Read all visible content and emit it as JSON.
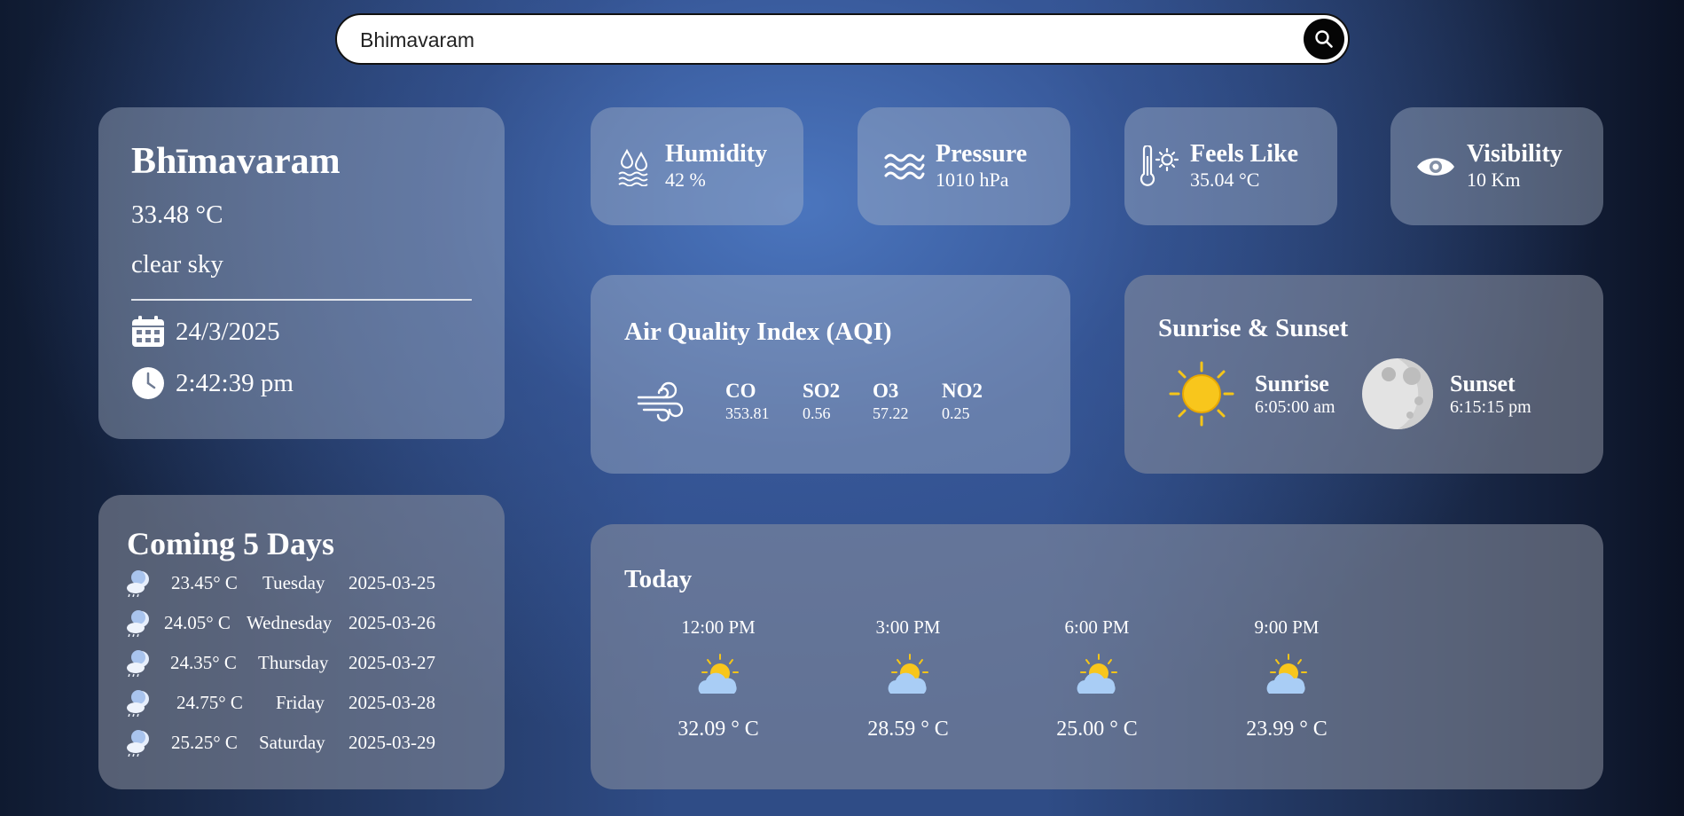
{
  "search": {
    "value": "Bhimavaram"
  },
  "current": {
    "city": "Bhīmavaram",
    "temperature": "33.48 °C",
    "description": "clear sky",
    "date": "24/3/2025",
    "time": "2:42:39 pm"
  },
  "stats": {
    "humidity": {
      "label": "Humidity",
      "value": "42 %"
    },
    "pressure": {
      "label": "Pressure",
      "value": "1010 hPa"
    },
    "feels_like": {
      "label": "Feels Like",
      "value": "35.04 °C"
    },
    "visibility": {
      "label": "Visibility",
      "value": "10 Km"
    }
  },
  "aqi": {
    "title": "Air Quality Index (AQI)",
    "items": [
      {
        "name": "CO",
        "value": "353.81"
      },
      {
        "name": "SO2",
        "value": "0.56"
      },
      {
        "name": "O3",
        "value": "57.22"
      },
      {
        "name": "NO2",
        "value": "0.25"
      }
    ]
  },
  "sun": {
    "title": "Sunrise & Sunset",
    "sunrise_label": "Sunrise",
    "sunrise": "6:05:00 am",
    "sunset_label": "Sunset",
    "sunset": "6:15:15 pm"
  },
  "forecast": {
    "title": "Coming 5 Days",
    "days": [
      {
        "temp": "23.45° C",
        "day": "Tuesday",
        "date": "2025-03-25"
      },
      {
        "temp": "24.05° C",
        "day": "Wednesday",
        "date": "2025-03-26"
      },
      {
        "temp": "24.35° C",
        "day": "Thursday",
        "date": "2025-03-27"
      },
      {
        "temp": "24.75° C",
        "day": "Friday",
        "date": "2025-03-28"
      },
      {
        "temp": "25.25° C",
        "day": "Saturday",
        "date": "2025-03-29"
      }
    ]
  },
  "today": {
    "title": "Today",
    "slots": [
      {
        "time": "12:00 PM",
        "temp": "32.09 ° C",
        "icon": "partly-cloudy-icon"
      },
      {
        "time": "3:00 PM",
        "temp": "28.59 ° C",
        "icon": "partly-cloudy-icon"
      },
      {
        "time": "6:00 PM",
        "temp": "25.00 ° C",
        "icon": "partly-cloudy-icon"
      },
      {
        "time": "9:00 PM",
        "temp": "23.99 ° C",
        "icon": "partly-cloudy-icon"
      }
    ]
  },
  "colors": {
    "sun": "#f5c518",
    "cloud": "#a9cdf5",
    "card": "#a9b3c8"
  }
}
